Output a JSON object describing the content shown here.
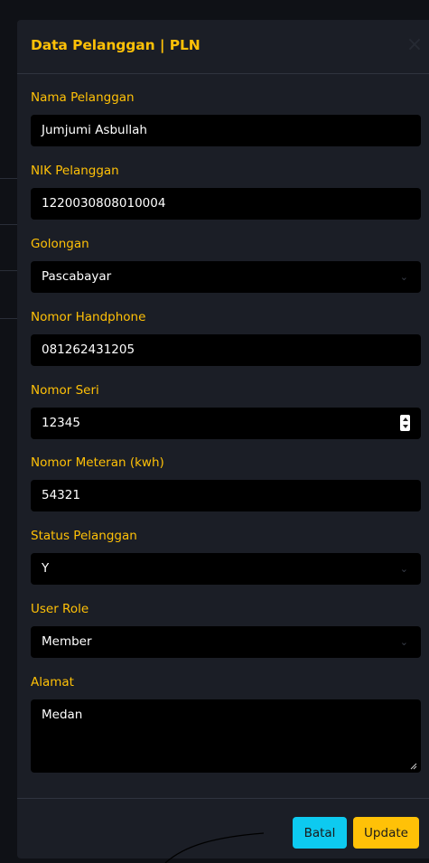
{
  "modal": {
    "title": "Data Pelanggan | PLN",
    "close_symbol": "×"
  },
  "fields": {
    "nama": {
      "label": "Nama Pelanggan",
      "value": "Jumjumi Asbullah"
    },
    "nik": {
      "label": "NIK Pelanggan",
      "value": "1220030808010004"
    },
    "golongan": {
      "label": "Golongan",
      "value": "Pascabayar"
    },
    "hp": {
      "label": "Nomor Handphone",
      "value": "081262431205"
    },
    "seri": {
      "label": "Nomor Seri",
      "value": "12345"
    },
    "meteran": {
      "label": "Nomor Meteran (kwh)",
      "value": "54321"
    },
    "status": {
      "label": "Status Pelanggan",
      "value": "Y"
    },
    "role": {
      "label": "User Role",
      "value": "Member"
    },
    "alamat": {
      "label": "Alamat",
      "value": "Medan"
    }
  },
  "footer": {
    "batal_label": "Batal",
    "update_label": "Update"
  },
  "icons": {
    "close": "close-icon",
    "chevron": "chevron-down-icon",
    "spinner": "number-spinner-icon",
    "resize": "resize-grip-icon"
  },
  "colors": {
    "accent": "#ffc107",
    "info": "#0dcaf0",
    "surface": "#1b1e26",
    "input_bg": "#000000"
  }
}
